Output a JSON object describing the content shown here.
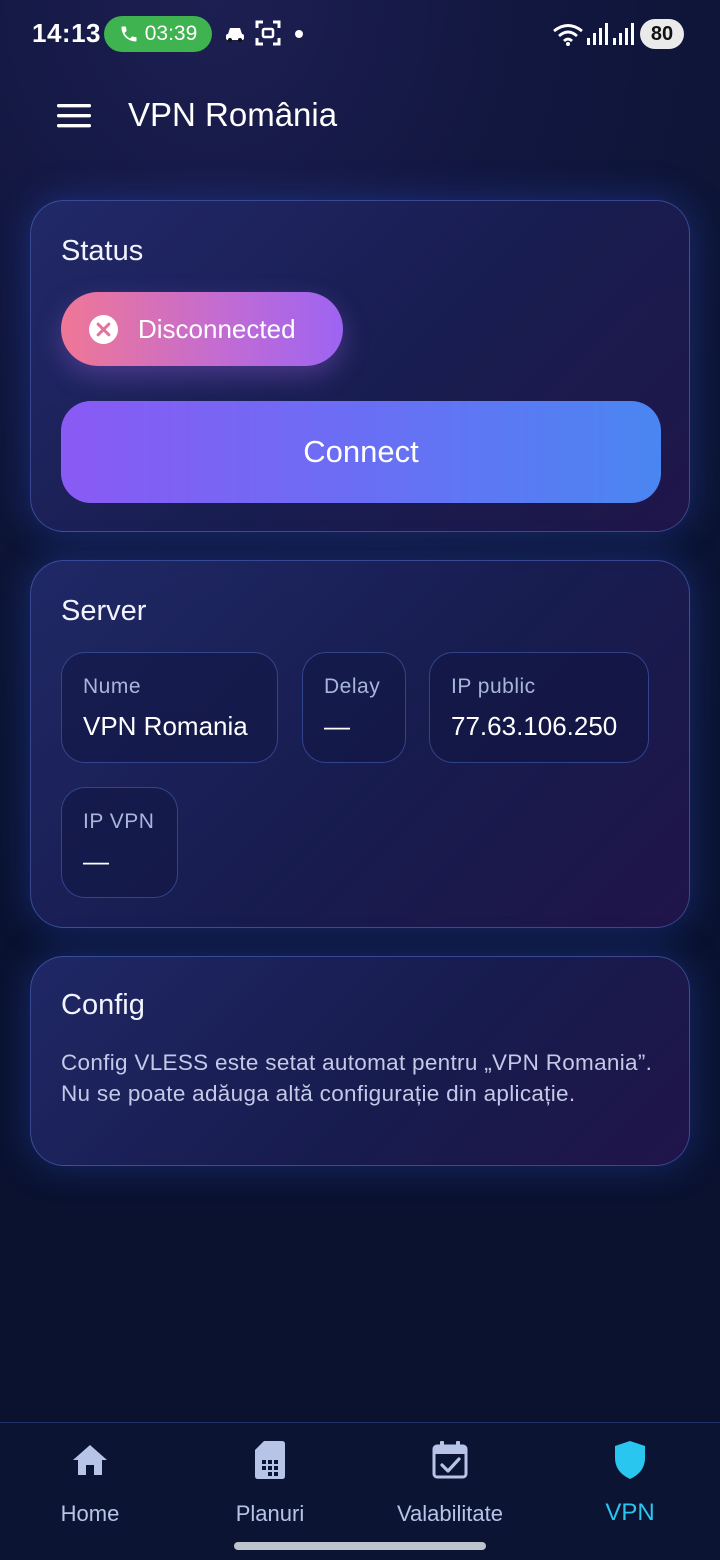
{
  "status_bar": {
    "time": "14:13",
    "call_duration": "03:39",
    "battery": "80"
  },
  "app_bar": {
    "title": "VPN România",
    "menu_icon": "hamburger-menu-icon"
  },
  "status_card": {
    "title": "Status",
    "state_label": "Disconnected",
    "state_icon": "close-circle-icon",
    "connect_label": "Connect"
  },
  "server_card": {
    "title": "Server",
    "name_label": "Nume",
    "name_value": "VPN Romania",
    "delay_label": "Delay",
    "delay_value": "—",
    "public_ip_label": "IP public",
    "public_ip_value": "77.63.106.250",
    "vpn_ip_label": "IP VPN",
    "vpn_ip_value": "—"
  },
  "config_card": {
    "title": "Config",
    "text": "Config VLESS este setat automat pentru „VPN Romania”. Nu se poate adăuga altă configurație din aplicație."
  },
  "bottom_nav": {
    "items": [
      {
        "label": "Home",
        "icon": "home-icon"
      },
      {
        "label": "Planuri",
        "icon": "sim-card-icon"
      },
      {
        "label": "Valabilitate",
        "icon": "calendar-check-icon"
      },
      {
        "label": "VPN",
        "icon": "shield-icon"
      }
    ],
    "active_index": 3,
    "active_color": "#29c6ef"
  }
}
